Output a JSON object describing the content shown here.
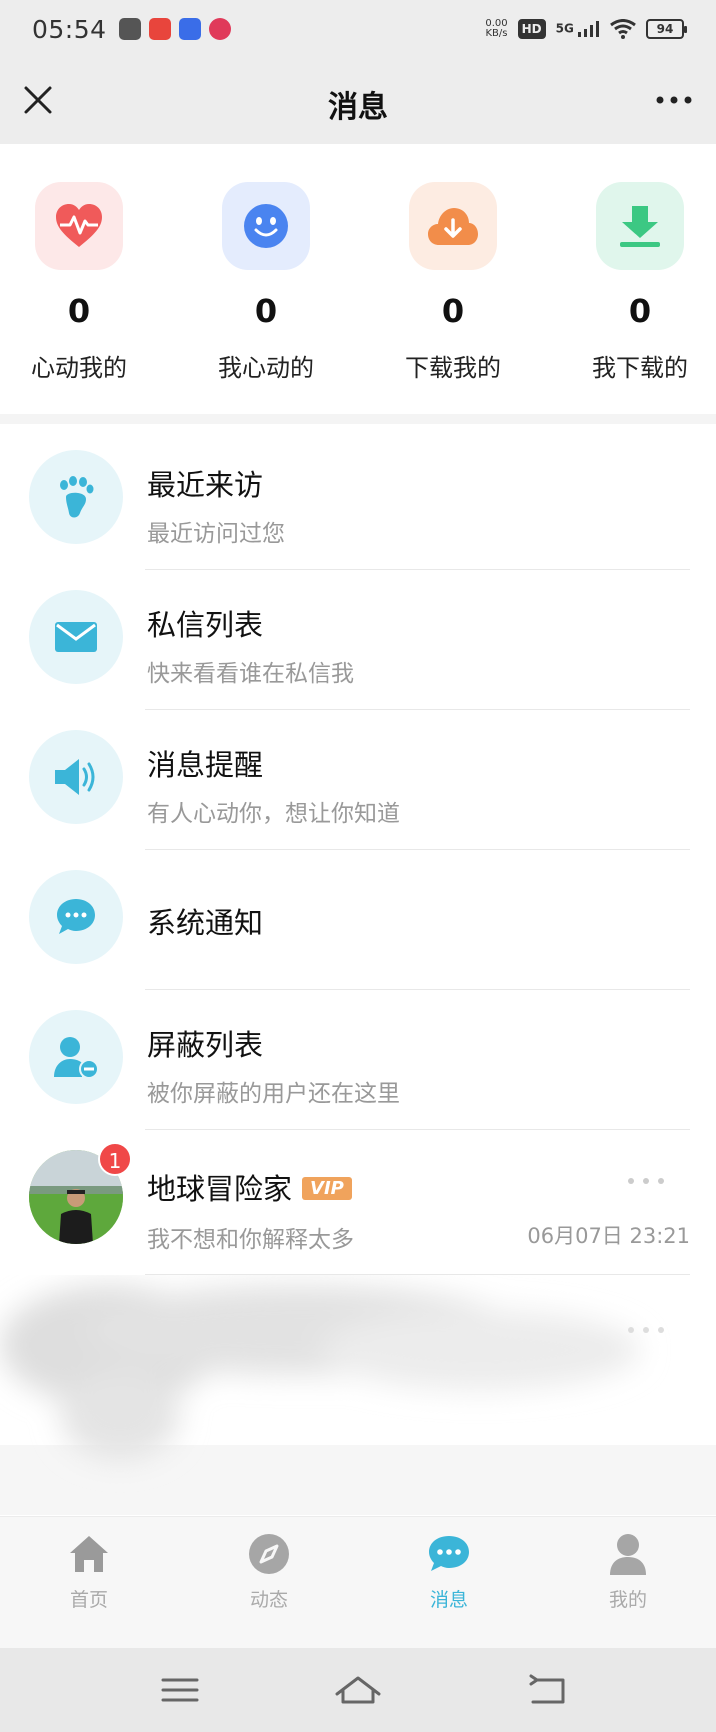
{
  "status_bar": {
    "time": "05:54",
    "net_speed": "0.00",
    "net_unit": "KB/s",
    "hd": "HD",
    "signal": "5G",
    "battery": "94"
  },
  "header": {
    "title": "消息"
  },
  "stats": [
    {
      "count": "0",
      "label": "心动我的",
      "icon": "heartbeat-icon",
      "bg": "#fde8e8",
      "color": "#f05a5a"
    },
    {
      "count": "0",
      "label": "我心动的",
      "icon": "smiley-icon",
      "bg": "#e4ecfd",
      "color": "#4a84f0"
    },
    {
      "count": "0",
      "label": "下载我的",
      "icon": "cloud-download-icon",
      "bg": "#fdece2",
      "color": "#f28d4a"
    },
    {
      "count": "0",
      "label": "我下载的",
      "icon": "download-icon",
      "bg": "#e0f6ec",
      "color": "#3cc883"
    }
  ],
  "menu": [
    {
      "title": "最近来访",
      "subtitle": "最近访问过您",
      "icon": "footprint-icon"
    },
    {
      "title": "私信列表",
      "subtitle": "快来看看谁在私信我",
      "icon": "mail-icon"
    },
    {
      "title": "消息提醒",
      "subtitle": "有人心动你，想让你知道",
      "icon": "speaker-icon"
    },
    {
      "title": "系统通知",
      "subtitle": "",
      "icon": "chat-bubble-icon"
    },
    {
      "title": "屏蔽列表",
      "subtitle": "被你屏蔽的用户还在这里",
      "icon": "block-user-icon"
    }
  ],
  "conversation": {
    "name": "地球冒险家",
    "vip": "VIP",
    "message": "我不想和你解释太多",
    "time": "06月07日 23:21",
    "unread": "1"
  },
  "tabs": [
    {
      "label": "首页",
      "icon": "home-icon"
    },
    {
      "label": "动态",
      "icon": "compass-icon"
    },
    {
      "label": "消息",
      "icon": "message-icon"
    },
    {
      "label": "我的",
      "icon": "profile-icon"
    }
  ],
  "active_tab": "消息",
  "accent_color": "#3bb5d8"
}
